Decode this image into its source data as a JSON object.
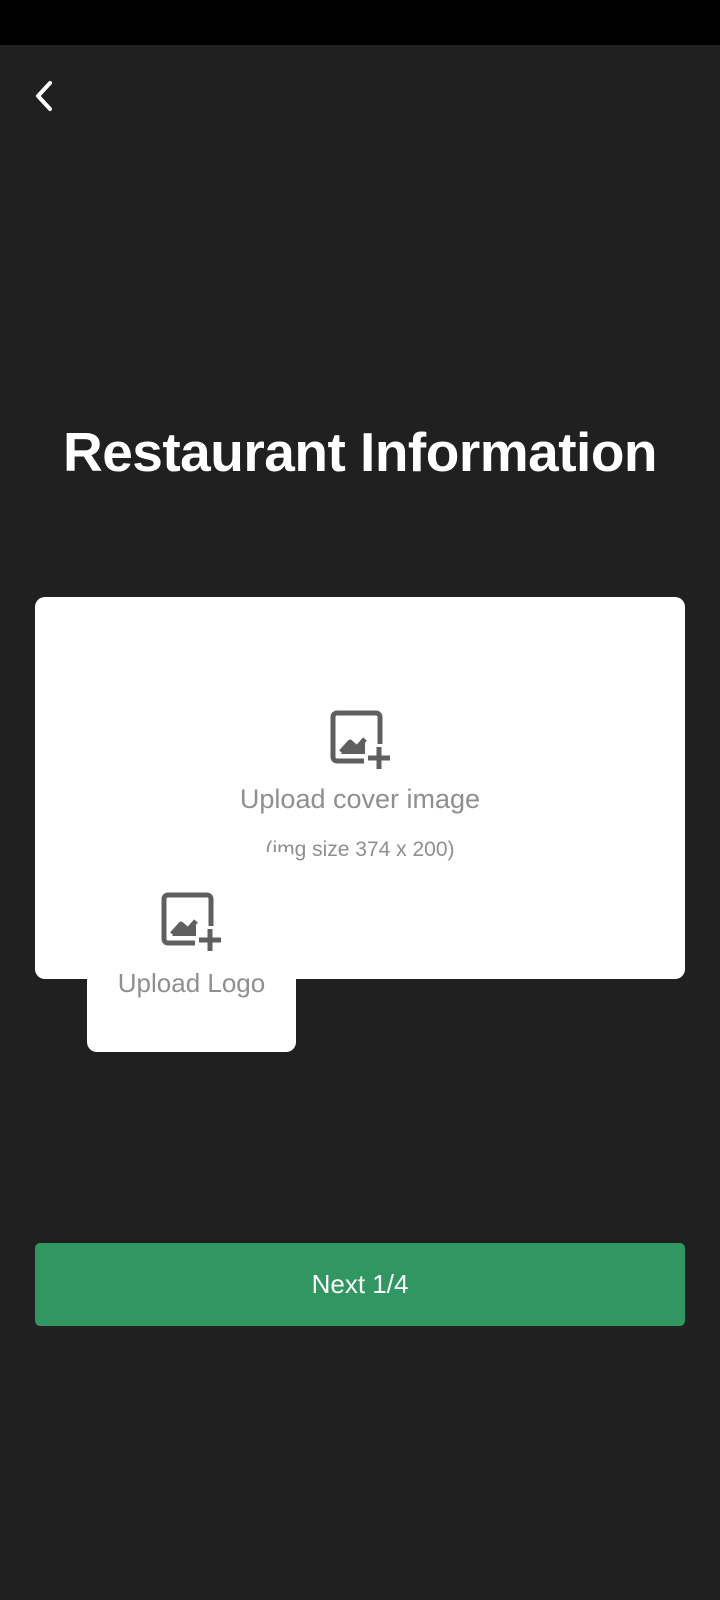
{
  "header": {
    "back_icon": "chevron-left-icon"
  },
  "page": {
    "title": "Restaurant Information"
  },
  "cover_upload": {
    "icon": "add-image-icon",
    "label": "Upload cover image",
    "hint": "(img size 374 x 200)"
  },
  "logo_upload": {
    "icon": "add-image-icon",
    "label": "Upload Logo"
  },
  "footer": {
    "next_label": "Next 1/4"
  },
  "colors": {
    "background": "#202020",
    "status_bar": "#000000",
    "card": "#ffffff",
    "muted_text": "#8f8f8f",
    "icon": "#5f5f5f",
    "accent": "#319762"
  }
}
